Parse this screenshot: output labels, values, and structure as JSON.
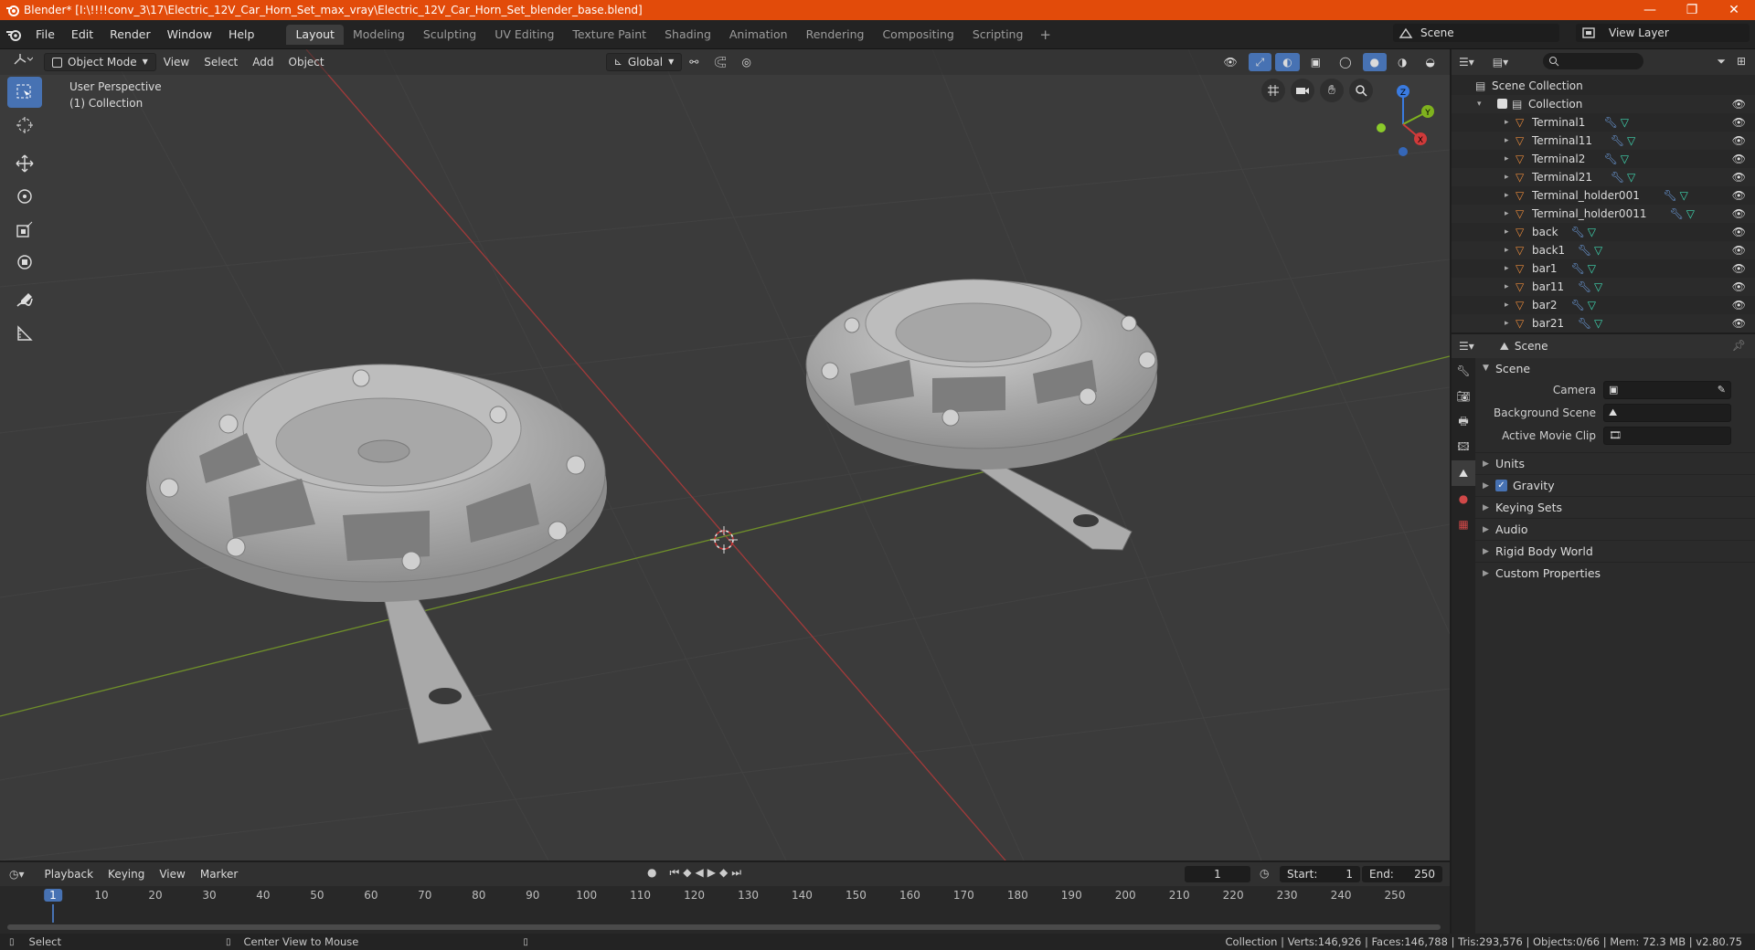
{
  "titlebar": {
    "title": "Blender* [I:\\!!!!conv_3\\17\\Electric_12V_Car_Horn_Set_max_vray\\Electric_12V_Car_Horn_Set_blender_base.blend]",
    "minimize": "—",
    "maximize": "❐",
    "close": "✕"
  },
  "menu": [
    "File",
    "Edit",
    "Render",
    "Window",
    "Help"
  ],
  "workspaces": [
    {
      "label": "Layout",
      "active": true
    },
    {
      "label": "Modeling"
    },
    {
      "label": "Sculpting"
    },
    {
      "label": "UV Editing"
    },
    {
      "label": "Texture Paint"
    },
    {
      "label": "Shading"
    },
    {
      "label": "Animation"
    },
    {
      "label": "Rendering"
    },
    {
      "label": "Compositing"
    },
    {
      "label": "Scripting"
    }
  ],
  "add_workspace": "+",
  "scene_name": "Scene",
  "view_layer_name": "View Layer",
  "viewport": {
    "mode": "Object Mode",
    "menus": [
      "View",
      "Select",
      "Add",
      "Object"
    ],
    "transform_orientation": "Global",
    "overlay_line1": "User Perspective",
    "overlay_line2": "(1) Collection",
    "axes": {
      "x": "X",
      "y": "Y",
      "z": "Z"
    }
  },
  "outliner": {
    "root": "Scene Collection",
    "collection": "Collection",
    "items": [
      "Terminal1",
      "Terminal11",
      "Terminal2",
      "Terminal21",
      "Terminal_holder001",
      "Terminal_holder0011",
      "back",
      "back1",
      "bar1",
      "bar11",
      "bar2",
      "bar21"
    ]
  },
  "properties": {
    "header": "Scene",
    "panel": "Scene",
    "fields": [
      {
        "label": "Camera"
      },
      {
        "label": "Background Scene"
      },
      {
        "label": "Active Movie Clip"
      }
    ],
    "subpanels": [
      "Units",
      "Gravity",
      "Keying Sets",
      "Audio",
      "Rigid Body World",
      "Custom Properties"
    ]
  },
  "timeline": {
    "menus": [
      "Playback",
      "Keying",
      "View",
      "Marker"
    ],
    "current_frame": "1",
    "start_label": "Start:",
    "start": "1",
    "end_label": "End:",
    "end": "250",
    "ruler": [
      "1",
      "10",
      "20",
      "30",
      "40",
      "50",
      "60",
      "70",
      "80",
      "90",
      "100",
      "110",
      "120",
      "130",
      "140",
      "150",
      "160",
      "170",
      "180",
      "190",
      "200",
      "210",
      "220",
      "230",
      "240",
      "250"
    ]
  },
  "statusbar": {
    "left": "Select",
    "middle": "Center View to Mouse",
    "right": "Collection | Verts:146,926 | Faces:146,788 | Tris:293,576 | Objects:0/66 | Mem: 72.3 MB | v2.80.75"
  },
  "colors": {
    "title_bar": "#e24b0a",
    "accent": "#4772b3",
    "object_icon": "#e8893a",
    "mesh_icon": "#3fd7b1",
    "modifier_icon": "#6e9fe0"
  }
}
